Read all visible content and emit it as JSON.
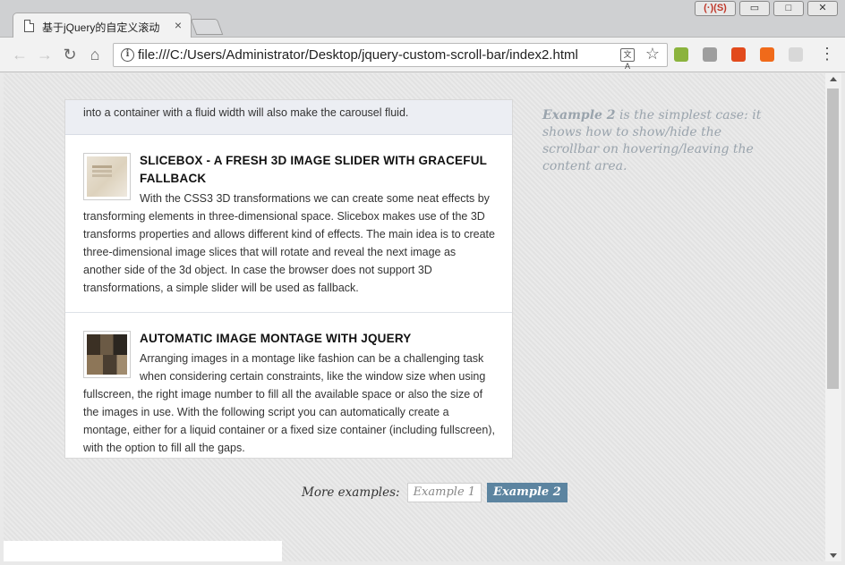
{
  "browser": {
    "tab_title": "基于jQuery的自定义滚动",
    "url": "file:///C:/Users/Administrator/Desktop/jquery-custom-scroll-bar/index2.html",
    "translate_label": "文A",
    "window_ext_label": "(·)(S)",
    "close_tab_glyph": "×",
    "back_glyph": "←",
    "forward_glyph": "→",
    "reload_glyph": "↻",
    "home_glyph": "⌂",
    "star_glyph": "☆",
    "menu_glyph": "⋮",
    "minimize_glyph": "▭",
    "maximize_glyph": "□",
    "close_glyph": "✕",
    "extensions": [
      {
        "icon": "android-icon",
        "color": "#8bb33d"
      },
      {
        "icon": "image-icon",
        "color": "#9e9e9e"
      },
      {
        "icon": "office-icon",
        "color": "#e24a1c"
      },
      {
        "icon": "infinity-icon",
        "color": "#f06a1a"
      },
      {
        "icon": "blank-extension-icon",
        "color": "#d8d8d8"
      }
    ]
  },
  "page": {
    "prev_snippet": "into a container with a fluid width will also make the carousel fluid.",
    "articles": [
      {
        "title": "SLICEBOX - A FRESH 3D IMAGE SLIDER WITH GRACEFUL FALLBACK",
        "body": "With the CSS3 3D transformations we can create some neat effects by transforming elements in three-dimensional space. Slicebox makes use of the 3D transforms properties and allows different kind of effects. The main idea is to create three-dimensional image slices that will rotate and reveal the next image as another side of the 3d object. In case the browser does not support 3D transformations, a simple slider will be used as fallback."
      },
      {
        "title": "AUTOMATIC IMAGE MONTAGE WITH JQUERY",
        "body": "Arranging images in a montage like fashion can be a challenging task when considering certain constraints, like the window size when using fullscreen, the right image number to fill all the available space or also the size of the images in use. With the following script you can automatically create a montage, either for a liquid container or a fixed size container (including fullscreen), with the option to fill all the gaps."
      }
    ],
    "side_note": {
      "lead": "Example 2",
      "rest": " is the simplest case: it shows how to show/hide the scrollbar on hovering/leaving the content area."
    },
    "more_examples": {
      "label": "More examples:",
      "buttons": [
        "Example 1",
        "Example 2"
      ],
      "active_index": 1
    }
  }
}
